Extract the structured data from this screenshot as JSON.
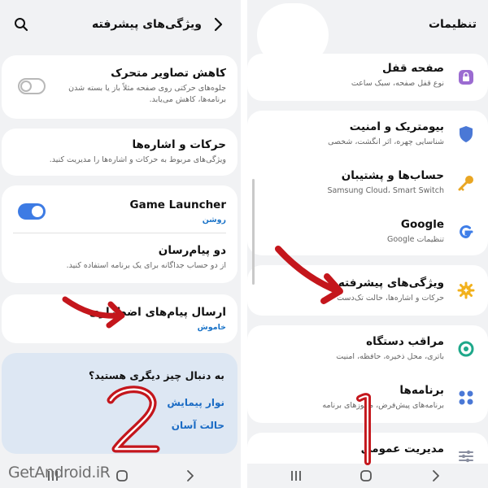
{
  "left_panel": {
    "title": "ویژگی‌های پیشرفته",
    "items": [
      {
        "title": "کاهش تصاویر متحرک",
        "subtitle_lines": [
          "جلوه‌های حرکتی روی صفحه مثلاً باز یا بسته شدن",
          "برنامه‌ها، کاهش می‌یابد."
        ]
      },
      {
        "title": "حرکات و اشاره‌ها",
        "subtitle": "ویژگی‌های مربوط به حرکات و اشاره‌ها را مدیریت کنید."
      },
      {
        "title": "Game Launcher",
        "status": "روشن"
      },
      {
        "title": "دو پیام‌رسان",
        "subtitle_lines": [
          "از دو حساب جداگانه برای یک برنامه استفاده کنید."
        ]
      },
      {
        "title": "ارسال پیام‌های اضطراری",
        "status": "خاموش"
      }
    ],
    "suggestion": {
      "title": "به دنبال چیز دیگری هستید؟",
      "links": [
        "نوار پیمایش",
        "حالت آسان"
      ]
    },
    "annotation_number": "2"
  },
  "right_panel": {
    "title": "تنظیمات",
    "items": [
      {
        "title": "صفحه قفل",
        "subtitle": "نوع قفل صفحه، سبک ساعت",
        "icon": "lock-icon",
        "color": "#9b6bd1"
      },
      {
        "title": "بیومتریک و امنیت",
        "subtitle": "شناسایی چهره، اثر انگشت، شخصی",
        "icon": "shield-icon",
        "color": "#4a78d6"
      },
      {
        "title": "حساب‌ها و پشتیبان",
        "subtitle": "Samsung Cloud، Smart Switch",
        "icon": "key-icon",
        "color": "#e9a623"
      },
      {
        "title": "Google",
        "subtitle": "تنظیمات Google",
        "icon": "google-icon",
        "color": "#3f7ee8"
      },
      {
        "title": "ویژگی‌های پیشرفته",
        "subtitle": "حرکات و اشاره‌ها، حالت تک‌دست",
        "icon": "gear-plus-icon",
        "color": "#f2b11c"
      },
      {
        "title": "مراقب دستگاه",
        "subtitle": "باتری، محل ذخیره، حافظه، امنیت",
        "icon": "device-care-icon",
        "color": "#1ea88a"
      },
      {
        "title": "برنامه‌ها",
        "subtitle": "برنامه‌های پیش‌فرض، مجوزهای برنامه",
        "icon": "apps-icon",
        "color": "#4a78d6"
      },
      {
        "title": "مدیریت عمومی",
        "icon": "sliders-icon",
        "color": "#8a8fa0"
      }
    ],
    "annotation_number": "1"
  },
  "watermark": "GetAndroid.iR",
  "annotation_color": "#c4161c"
}
